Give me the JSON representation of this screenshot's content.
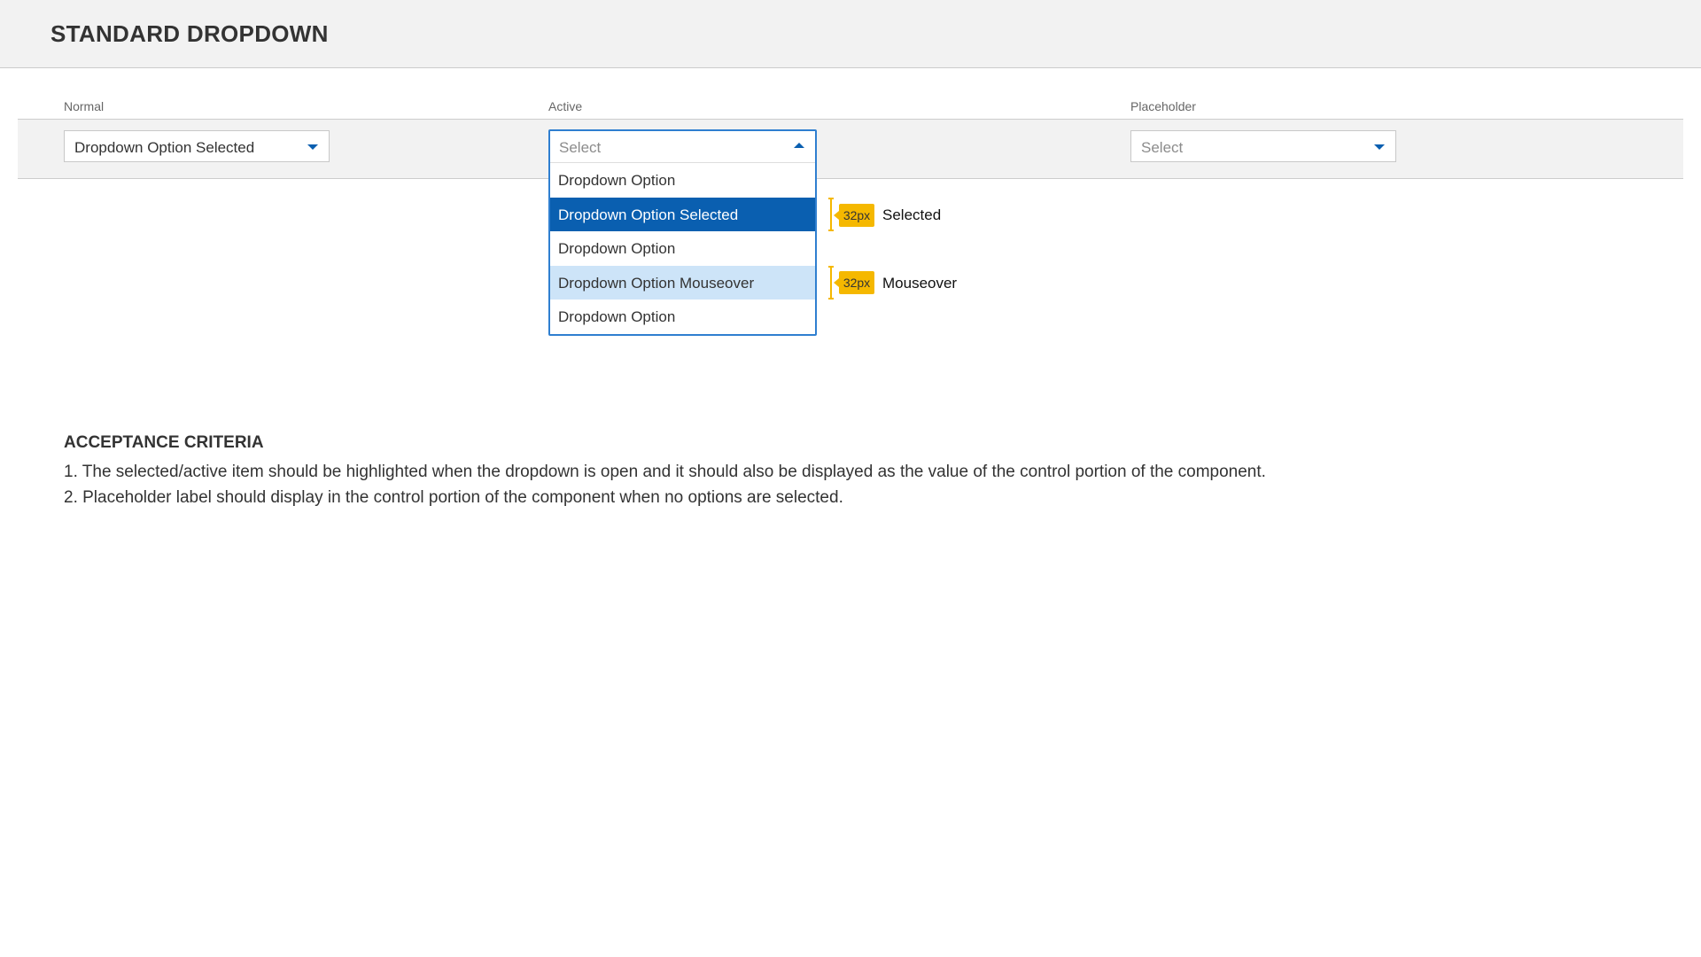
{
  "header": {
    "title": "STANDARD DROPDOWN"
  },
  "columns": {
    "normal_label": "Normal",
    "active_label": "Active",
    "placeholder_label": "Placeholder"
  },
  "normal_dropdown": {
    "value": "Dropdown Option Selected",
    "caret_icon": "caret-down-icon"
  },
  "active_dropdown": {
    "placeholder": "Select",
    "caret_icon": "caret-up-icon",
    "options": [
      {
        "label": "Dropdown Option",
        "state": "default"
      },
      {
        "label": "Dropdown Option Selected",
        "state": "selected"
      },
      {
        "label": "Dropdown Option",
        "state": "default"
      },
      {
        "label": "Dropdown Option Mouseover",
        "state": "mouseover"
      },
      {
        "label": "Dropdown Option",
        "state": "default"
      }
    ]
  },
  "placeholder_dropdown": {
    "placeholder": "Select",
    "caret_icon": "caret-down-icon"
  },
  "annotations": [
    {
      "size": "32px",
      "label": "Selected"
    },
    {
      "size": "32px",
      "label": "Mouseover"
    }
  ],
  "criteria": {
    "title": "ACCEPTANCE CRITERIA",
    "items": [
      "1. The selected/active item should be highlighted when the dropdown is open and it should also be displayed as the value of the control portion of the component.",
      "2. Placeholder label should display in the control portion of the component when no options are selected."
    ]
  },
  "colors": {
    "header_bg": "#f2f2f2",
    "accent": "#0a5fb0",
    "selected_bg": "#0a5fb0",
    "mouseover_bg": "#cde4f8",
    "active_border": "#2f7fd0",
    "annotation": "#f5b800"
  }
}
